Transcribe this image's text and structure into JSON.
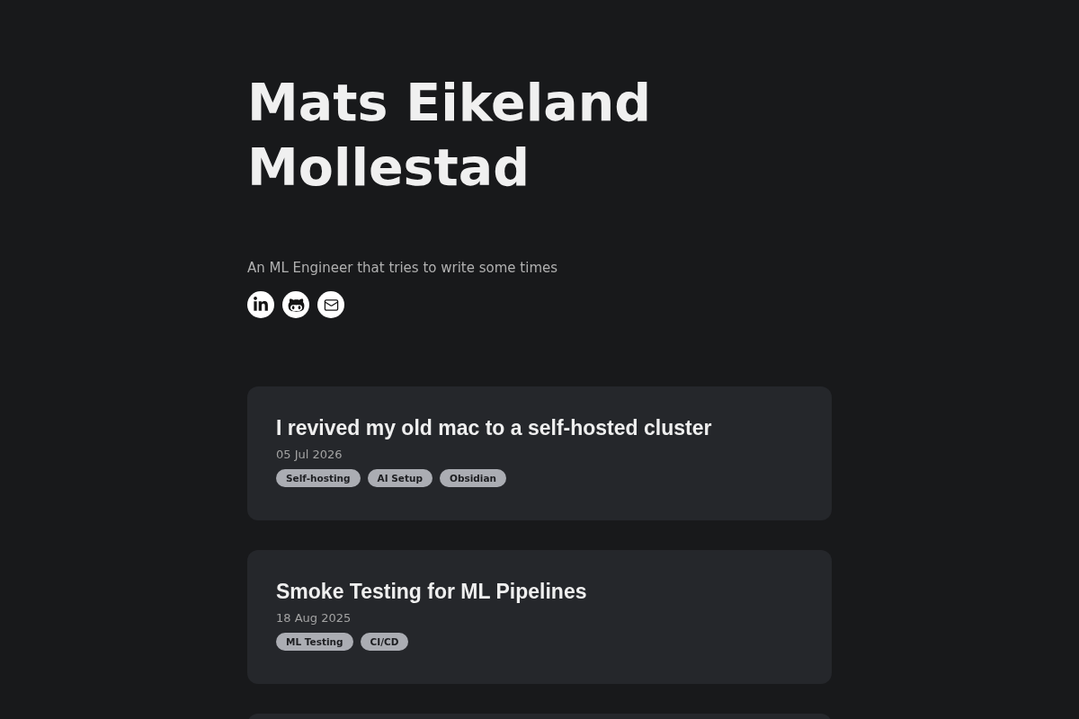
{
  "header": {
    "name": "Mats Eikeland Mollestad",
    "tagline": "An ML Engineer that tries to write some times",
    "social_links": [
      {
        "kind": "linkedin"
      },
      {
        "kind": "github"
      },
      {
        "kind": "email"
      }
    ]
  },
  "posts": [
    {
      "title": "I revived my old mac to a self-hosted cluster",
      "date": "05 Jul 2026",
      "tags": [
        "Self-hosting",
        "AI Setup",
        "Obsidian"
      ]
    },
    {
      "title": "Smoke Testing for ML Pipelines",
      "date": "18 Aug 2025",
      "tags": [
        "ML Testing",
        "CI/CD"
      ]
    }
  ],
  "posts_continue_below": true
}
